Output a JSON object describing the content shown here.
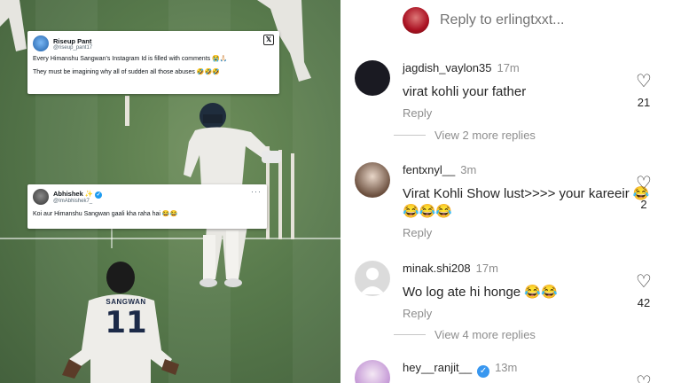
{
  "tweet1": {
    "name": "Riseup Pant",
    "handle": "@riseup_pant17",
    "line1": "Every Himanshu Sangwan's Instagram Id is filled with comments 😭🙏🏻",
    "line2": "They must be imagining why all of sudden all those abuses 🤣🤣🤣"
  },
  "tweet2": {
    "name": "Abhishek",
    "name_emoji": "✨",
    "handle": "@ImAbhishek7_",
    "text": "Koi aur Himanshu Sangwan gaali kha raha hai 😂😂"
  },
  "jersey": {
    "name": "SANGWAN",
    "number": "11"
  },
  "reply_bar": {
    "placeholder": "Reply to erlingtxxt..."
  },
  "comments": [
    {
      "user": "jagdish_vaylon35",
      "time": "17m",
      "text": "virat kohli your father",
      "reply": "Reply",
      "likes": "21",
      "view_more": "View 2 more replies"
    },
    {
      "user": "fentxnyl__",
      "time": "3m",
      "text": "Virat Kohli Show lust>>>> your kareeir 😂😂😂😂",
      "reply": "Reply",
      "likes": "2"
    },
    {
      "user": "minak.shi208",
      "time": "17m",
      "text": "Wo log ate hi honge 😂😂",
      "reply": "Reply",
      "likes": "42",
      "view_more": "View 4 more replies"
    },
    {
      "user": "hey__ranjit__",
      "time": "13m"
    }
  ],
  "colors": {
    "grass": "#587a4c",
    "verified": "#3897f0",
    "text": "#262626",
    "muted": "#8e8e8e"
  }
}
